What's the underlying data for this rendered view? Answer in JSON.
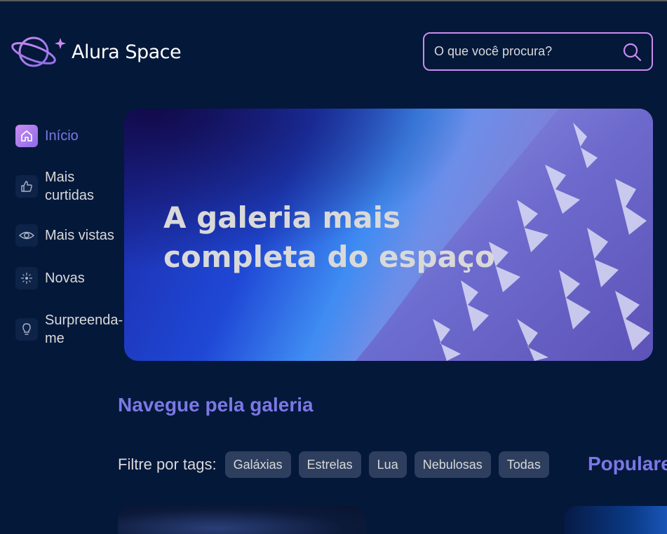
{
  "header": {
    "logo_text": "Alura Space",
    "search_placeholder": "O que você procura?"
  },
  "sidebar": {
    "items": [
      {
        "label": "Início",
        "icon": "home-icon",
        "active": true
      },
      {
        "label": "Mais curtidas",
        "icon": "thumbs-up-icon",
        "active": false
      },
      {
        "label": "Mais vistas",
        "icon": "eye-icon",
        "active": false
      },
      {
        "label": "Novas",
        "icon": "sparkle-icon",
        "active": false
      },
      {
        "label": "Surpreenda-me",
        "icon": "lightbulb-icon",
        "active": false
      }
    ]
  },
  "banner": {
    "title": "A galeria mais completa do espaço"
  },
  "gallery": {
    "title": "Navegue pela galeria",
    "filter_label": "Filtre por tags:",
    "tags": [
      "Galáxias",
      "Estrelas",
      "Lua",
      "Nebulosas",
      "Todas"
    ]
  },
  "popular": {
    "title": "Populares"
  },
  "colors": {
    "background": "#04183a",
    "accent": "#7b78e5",
    "search_border": "#c98cf1",
    "tag_bg": "#2d3e5e"
  }
}
